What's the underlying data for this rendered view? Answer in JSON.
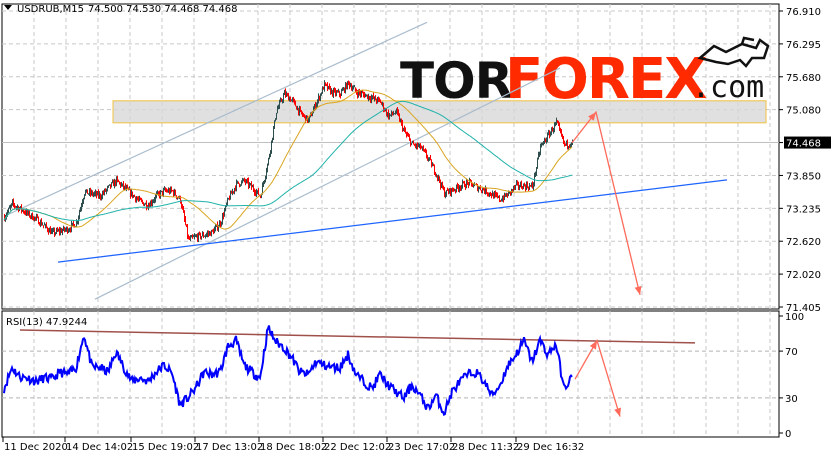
{
  "header": {
    "symbol": "USDRUB,M15",
    "ohlc": "74.500 74.530 74.468 74.468"
  },
  "logo": {
    "part1": "TOR",
    "part2": "FOREX",
    "part3": ".com",
    "icon": "bull-icon"
  },
  "colors": {
    "bull": "#2f4f4f",
    "bear": "#ff0000",
    "ma_fast": "#daa520",
    "ma_slow": "#20b2aa",
    "support": "#1e64ff",
    "channel": "#a9bccd",
    "arrows": "#ff6a5a",
    "rsi": "#0000ff",
    "rsi_trendline": "#a0504a",
    "zone_fill": "#d8d8d8",
    "zone_border": "#f0c040",
    "logo_dark": "#111111",
    "logo_red": "#ff2a00"
  },
  "chart_data": [
    {
      "type": "candlestick",
      "title": "USDRUB,M15",
      "ylim": [
        71.405,
        76.91
      ],
      "y_ticks": [
        "76.910",
        "76.295",
        "75.680",
        "75.080",
        "74.468",
        "73.850",
        "73.235",
        "72.620",
        "72.020",
        "71.405"
      ],
      "current_price": "74.468",
      "x_ticks": [
        "11 Dec 2020",
        "14 Dec 14:02",
        "15 Dec 19:02",
        "17 Dec 13:02",
        "18 Dec 18:02",
        "22 Dec 12:02",
        "23 Dec 17:02",
        "28 Dec 11:32",
        "29 Dec 16:32"
      ],
      "grid": true,
      "approx_closes": [
        73.08,
        73.32,
        73.23,
        73.13,
        73.04,
        72.91,
        72.78,
        72.82,
        72.86,
        72.97,
        73.54,
        73.51,
        73.47,
        73.62,
        73.75,
        73.62,
        73.49,
        73.36,
        73.3,
        73.47,
        73.56,
        73.56,
        73.4,
        72.65,
        72.71,
        72.74,
        72.8,
        72.97,
        73.41,
        73.69,
        73.75,
        73.62,
        73.47,
        74.14,
        75.05,
        75.37,
        75.24,
        75.01,
        74.87,
        75.2,
        75.53,
        75.39,
        75.37,
        75.57,
        75.4,
        75.35,
        75.29,
        75.22,
        74.96,
        75.03,
        74.66,
        74.42,
        74.38,
        74.16,
        73.88,
        73.52,
        73.58,
        73.66,
        73.71,
        73.64,
        73.58,
        73.49,
        73.4,
        73.51,
        73.66,
        73.66,
        73.64,
        74.38,
        74.6,
        74.83,
        74.42,
        74.468
      ],
      "moving_averages": [
        "fast",
        "slow"
      ],
      "annotations": {
        "resistance_zone": [
          74.83,
          75.24
        ],
        "support_line": [
          72.24,
          73.77
        ],
        "channel_upper": [
          73.1,
          76.7
        ],
        "channel_lower": [
          71.55,
          75.85
        ],
        "forecast_arrows": [
          74.46,
          75.03,
          71.63
        ]
      }
    },
    {
      "type": "line",
      "title": "RSI(13) 47.9244",
      "ylim": [
        0,
        100
      ],
      "y_ticks": [
        "100",
        "70",
        "30",
        "0"
      ],
      "levels": [
        70,
        30
      ],
      "approx_values": [
        38,
        56,
        48,
        47,
        44,
        47,
        46,
        52,
        50,
        56,
        84,
        56,
        56,
        52,
        69,
        56,
        44,
        47,
        44,
        52,
        58,
        51,
        24,
        30,
        39,
        52,
        50,
        52,
        74,
        79,
        58,
        52,
        47,
        90,
        78,
        73,
        64,
        52,
        50,
        61,
        58,
        56,
        56,
        67,
        50,
        44,
        38,
        50,
        41,
        35,
        30,
        41,
        32,
        21,
        32,
        17,
        35,
        44,
        50,
        52,
        44,
        32,
        41,
        58,
        67,
        79,
        61,
        79,
        67,
        76,
        38,
        47.92
      ],
      "annotations": {
        "trendline": [
          88,
          77
        ],
        "forecast_arrows": [
          46,
          79,
          14
        ]
      }
    }
  ]
}
